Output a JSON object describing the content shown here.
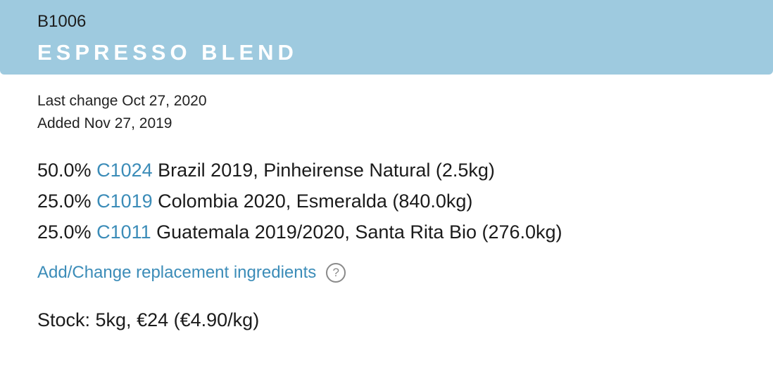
{
  "header": {
    "blend_id": "B1006",
    "blend_name": "ESPRESSO BLEND"
  },
  "meta": {
    "last_change": "Last change Oct 27, 2020",
    "added": "Added Nov 27, 2019"
  },
  "ingredients": [
    {
      "percent": "50.0%",
      "code": "C1024",
      "description": "Brazil 2019, Pinheirense Natural (2.5kg)"
    },
    {
      "percent": "25.0%",
      "code": "C1019",
      "description": "Colombia 2020, Esmeralda (840.0kg)"
    },
    {
      "percent": "25.0%",
      "code": "C1011",
      "description": "Guatemala 2019/2020, Santa Rita Bio (276.0kg)"
    }
  ],
  "replacement": {
    "link_label": "Add/Change replacement ingredients",
    "help_icon": "question-circle-icon",
    "help_glyph": "?"
  },
  "stock": {
    "text": "Stock: 5kg, €24 (€4.90/kg)"
  },
  "colors": {
    "header_bg": "#9ecadf",
    "link": "#3b8cb8",
    "header_title": "#ffffff"
  }
}
